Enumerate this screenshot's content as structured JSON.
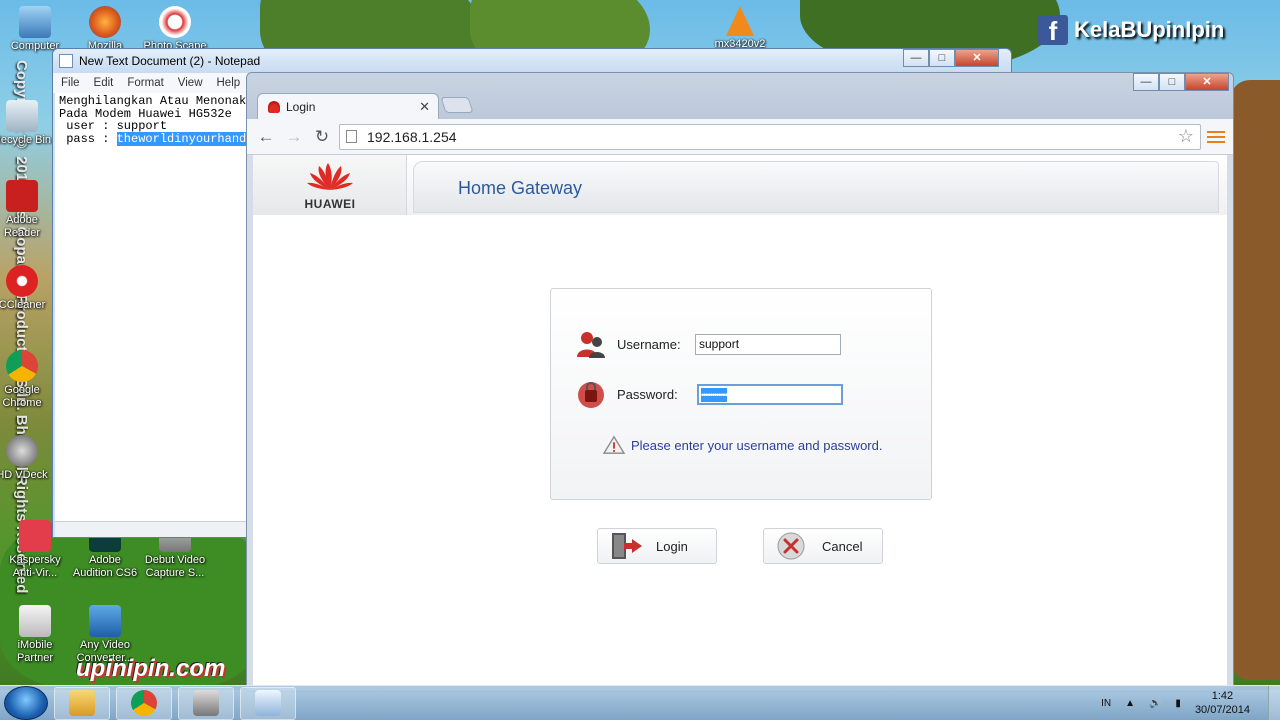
{
  "desktop": {
    "side_text": "Copyright © 2011 Les' Copaque Production Sdn. Bhd. All Rights Reserved",
    "bottom_brand": "upinipin.com",
    "fb_text": "KelaBUpinIpin",
    "icons": [
      {
        "label": "Computer"
      },
      {
        "label": "Mozilla Firefox"
      },
      {
        "label": "Photo Scape"
      },
      {
        "label": "mx3420v2"
      },
      {
        "label": "Recycle Bin"
      },
      {
        "label": "Adobe Reader"
      },
      {
        "label": "CCleaner"
      },
      {
        "label": "Google Chrome"
      },
      {
        "label": "HD VDeck"
      },
      {
        "label": "Kaspersky Anti-Vir..."
      },
      {
        "label": "Adobe Audition CS6"
      },
      {
        "label": "Debut Video Capture S..."
      },
      {
        "label": "iMobile Partner"
      },
      {
        "label": "Any Video Converter..."
      }
    ]
  },
  "notepad": {
    "title": "New Text Document (2) - Notepad",
    "menu": [
      "File",
      "Edit",
      "Format",
      "View",
      "Help"
    ],
    "lines": [
      "Menghilangkan Atau Menonaktifkan",
      "Pada Modem Huawei HG532e",
      " user : support",
      " pass : "
    ],
    "selected_text": "theworldinyourhand"
  },
  "browser": {
    "tab_title": "Login",
    "url": "192.168.1.254"
  },
  "page": {
    "logo_text": "HUAWEI",
    "header_title": "Home Gateway",
    "username_label": "Username:",
    "username_value": "support",
    "password_label": "Password:",
    "password_mask": "••••••••••••",
    "message": "Please enter your username and password.",
    "login_button": "Login",
    "cancel_button": "Cancel"
  },
  "taskbar": {
    "language": "IN",
    "time": "1:42",
    "date": "30/07/2014"
  },
  "colors": {
    "gateway_title": "#2e5a9c",
    "message": "#2b3f9e",
    "selection": "#3399ff",
    "brand_red": "#e02b25"
  }
}
